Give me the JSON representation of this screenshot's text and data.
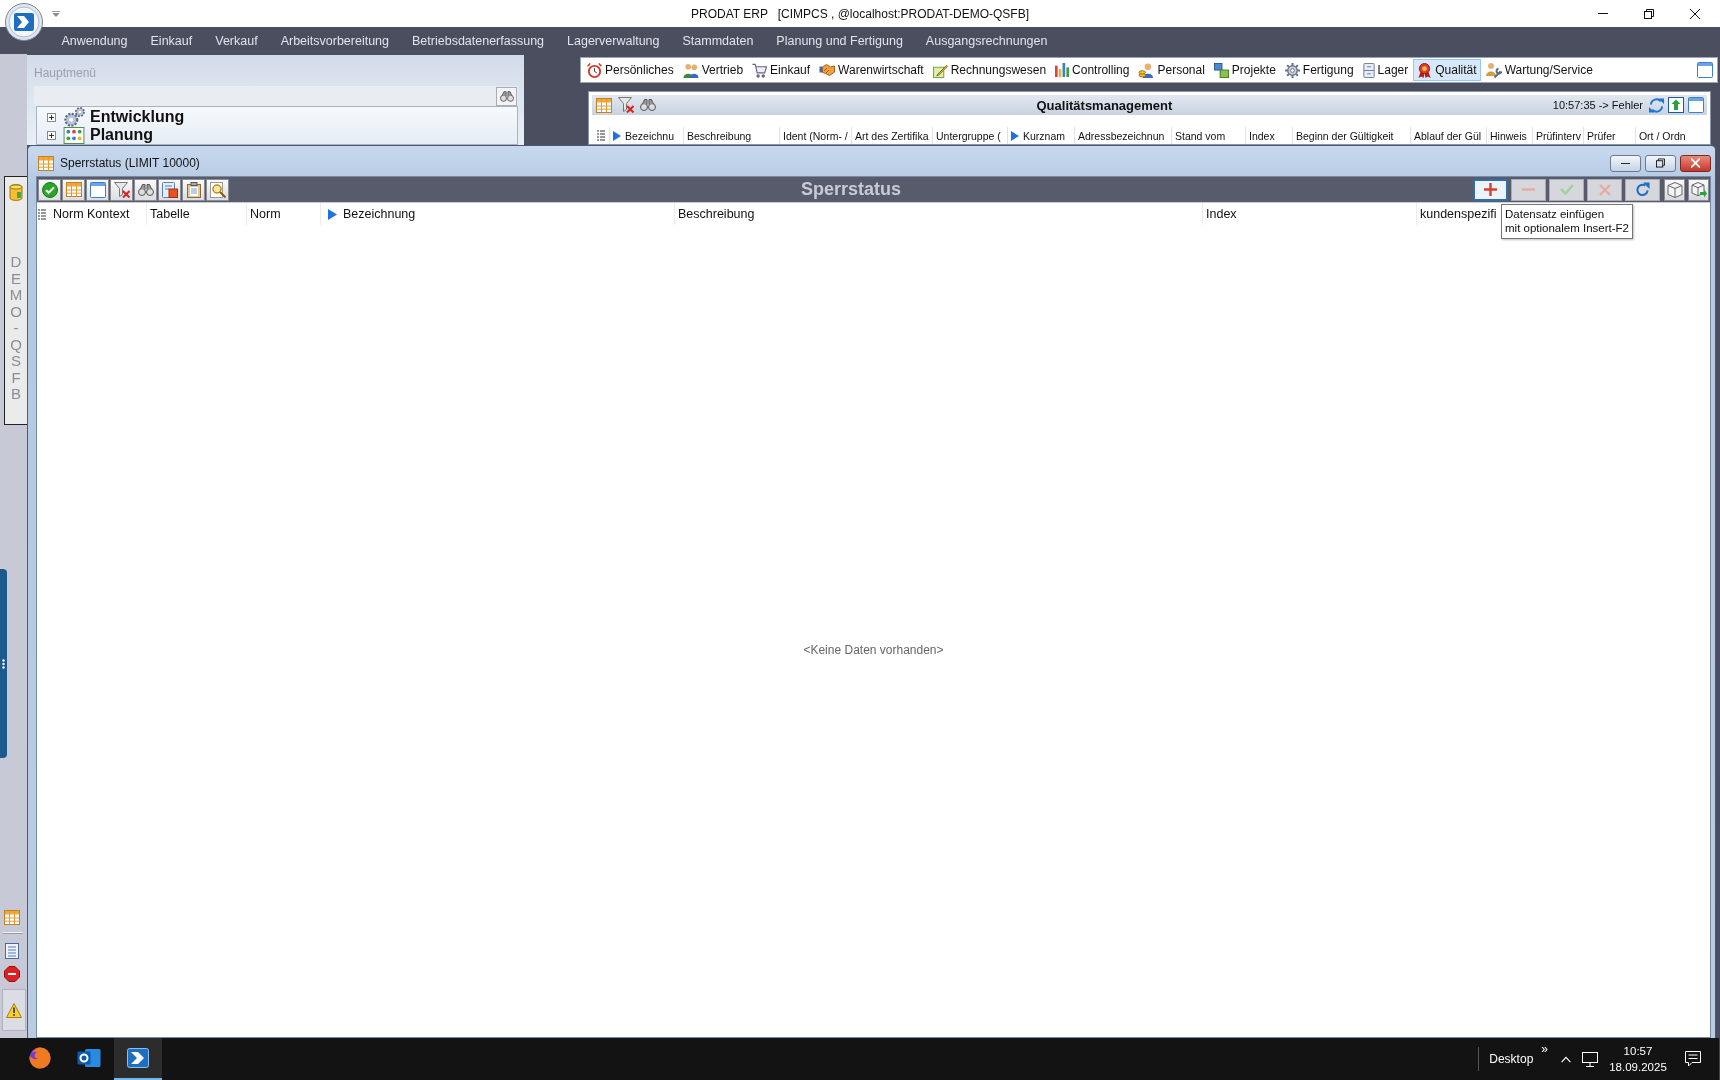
{
  "window": {
    "title": "PRODAT ERP   [CIMPCS , @localhost:PRODAT-DEMO-QSFB]"
  },
  "menu": [
    "Anwendung",
    "Einkauf",
    "Verkauf",
    "Arbeitsvorbereitung",
    "Betriebsdatenerfassung",
    "Lagerverwaltung",
    "Stammdaten",
    "Planung und Fertigung",
    "Ausgangsrechnungen"
  ],
  "main_menu": {
    "title": "Hauptmenü",
    "tree": [
      {
        "label": "Entwicklung",
        "expanded": false
      },
      {
        "label": "Planung",
        "expanded": false
      }
    ]
  },
  "module_tabs": [
    {
      "label": "Persönliches",
      "selected": false
    },
    {
      "label": "Vertrieb",
      "selected": false
    },
    {
      "label": "Einkauf",
      "selected": false
    },
    {
      "label": "Warenwirtschaft",
      "selected": false
    },
    {
      "label": "Rechnungswesen",
      "selected": false
    },
    {
      "label": "Controlling",
      "selected": false
    },
    {
      "label": "Personal",
      "selected": false
    },
    {
      "label": "Projekte",
      "selected": false
    },
    {
      "label": "Fertigung",
      "selected": false
    },
    {
      "label": "Lager",
      "selected": false
    },
    {
      "label": "Qualität",
      "selected": true
    },
    {
      "label": "Wartung/Service",
      "selected": false
    }
  ],
  "quality_panel": {
    "title": "Qualitätsmanagement",
    "status": "10:57:35 -> Fehler",
    "columns": [
      {
        "label": "Bezeichnu",
        "sorted": true
      },
      {
        "label": "Beschreibung",
        "sorted": false
      },
      {
        "label": "Ident (Norm- /",
        "sorted": false
      },
      {
        "label": "Art des Zertifika",
        "sorted": false
      },
      {
        "label": "Untergruppe (",
        "sorted": false
      },
      {
        "label": "Kurznam",
        "sorted": true
      },
      {
        "label": "Adressbezeichnun",
        "sorted": false
      },
      {
        "label": "Stand vom",
        "sorted": false
      },
      {
        "label": "Index",
        "sorted": false
      },
      {
        "label": "Beginn der Gültigkeit",
        "sorted": false
      },
      {
        "label": "Ablauf der Gül",
        "sorted": false
      },
      {
        "label": "Hinweis",
        "sorted": false
      },
      {
        "label": "Prüfinterv",
        "sorted": false
      },
      {
        "label": "Prüfer",
        "sorted": false
      },
      {
        "label": "Ort / Ordn",
        "sorted": false
      }
    ]
  },
  "side_strip": {
    "database_label": "DEMO-QSFB"
  },
  "sperrstatus": {
    "title": "Sperrstatus (LIMIT 10000)",
    "toolbar_title": "Sperrstatus",
    "actions": [
      {
        "kind": "add",
        "disabled": false,
        "focused": true
      },
      {
        "kind": "delete",
        "disabled": true,
        "focused": false
      },
      {
        "kind": "save",
        "disabled": true,
        "focused": false
      },
      {
        "kind": "cancel",
        "disabled": true,
        "focused": false
      },
      {
        "kind": "refresh",
        "disabled": false,
        "focused": false
      }
    ],
    "columns": [
      {
        "label": "Norm Kontext",
        "sorted": false
      },
      {
        "label": "Tabelle",
        "sorted": false
      },
      {
        "label": "Norm",
        "sorted": false
      },
      {
        "label": "Bezeichnung",
        "sorted": true
      },
      {
        "label": "Beschreibung",
        "sorted": false
      },
      {
        "label": "Index",
        "sorted": false
      },
      {
        "label": "kundenspezifi",
        "sorted": false
      }
    ],
    "empty_message": "<Keine Daten vorhanden>",
    "tooltip": "Datensatz einfügen\nmit optionalem Insert-F2"
  },
  "taskbar": {
    "apps": [
      {
        "kind": "browser",
        "active": false
      },
      {
        "kind": "mail",
        "active": false
      },
      {
        "kind": "erp",
        "active": true
      }
    ],
    "desktop_label": "Desktop",
    "overflow": "»",
    "time": "10:57",
    "date": "18.09.2025"
  }
}
